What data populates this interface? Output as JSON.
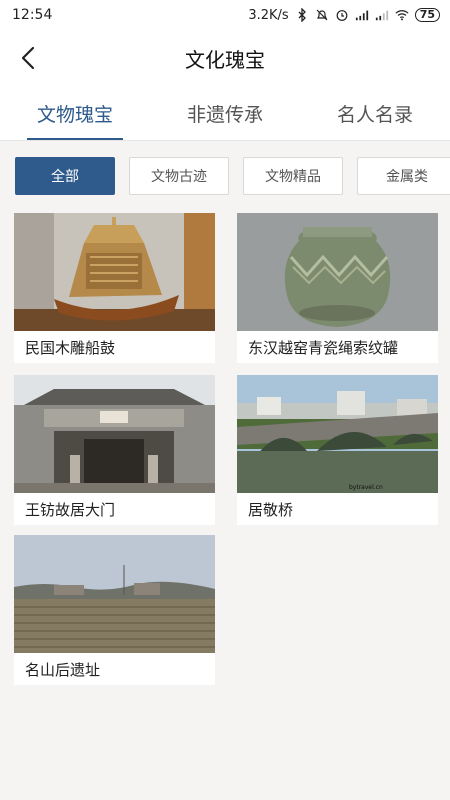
{
  "status_bar": {
    "time": "12:54",
    "net_speed": "3.2K/s",
    "battery": "75",
    "icons": [
      "bluetooth-icon",
      "mute-icon",
      "alarm-icon",
      "hd-signal-icon",
      "signal-icon",
      "wifi-icon",
      "battery-icon"
    ]
  },
  "header": {
    "title": "文化瑰宝",
    "back_icon": "chevron-left-icon"
  },
  "tabs": [
    {
      "label": "文物瑰宝",
      "active": true
    },
    {
      "label": "非遗传承",
      "active": false
    },
    {
      "label": "名人名录",
      "active": false
    }
  ],
  "filters": [
    {
      "label": "全部",
      "active": true
    },
    {
      "label": "文物古迹",
      "active": false
    },
    {
      "label": "文物精品",
      "active": false
    },
    {
      "label": "金属类",
      "active": false
    }
  ],
  "items": [
    {
      "title": "民国木雕船鼓",
      "image": "carved-wooden-boat-drum"
    },
    {
      "title": "东汉越窑青瓷绳索纹罐",
      "image": "celadon-rope-pattern-jar"
    },
    {
      "title": "王钫故居大门",
      "image": "old-residence-gate"
    },
    {
      "title": "居敬桥",
      "image": "stone-arch-bridge"
    },
    {
      "title": "名山后遗址",
      "image": "field-site"
    }
  ],
  "colors": {
    "accent": "#2e5a8c",
    "background": "#f5f4f2"
  }
}
